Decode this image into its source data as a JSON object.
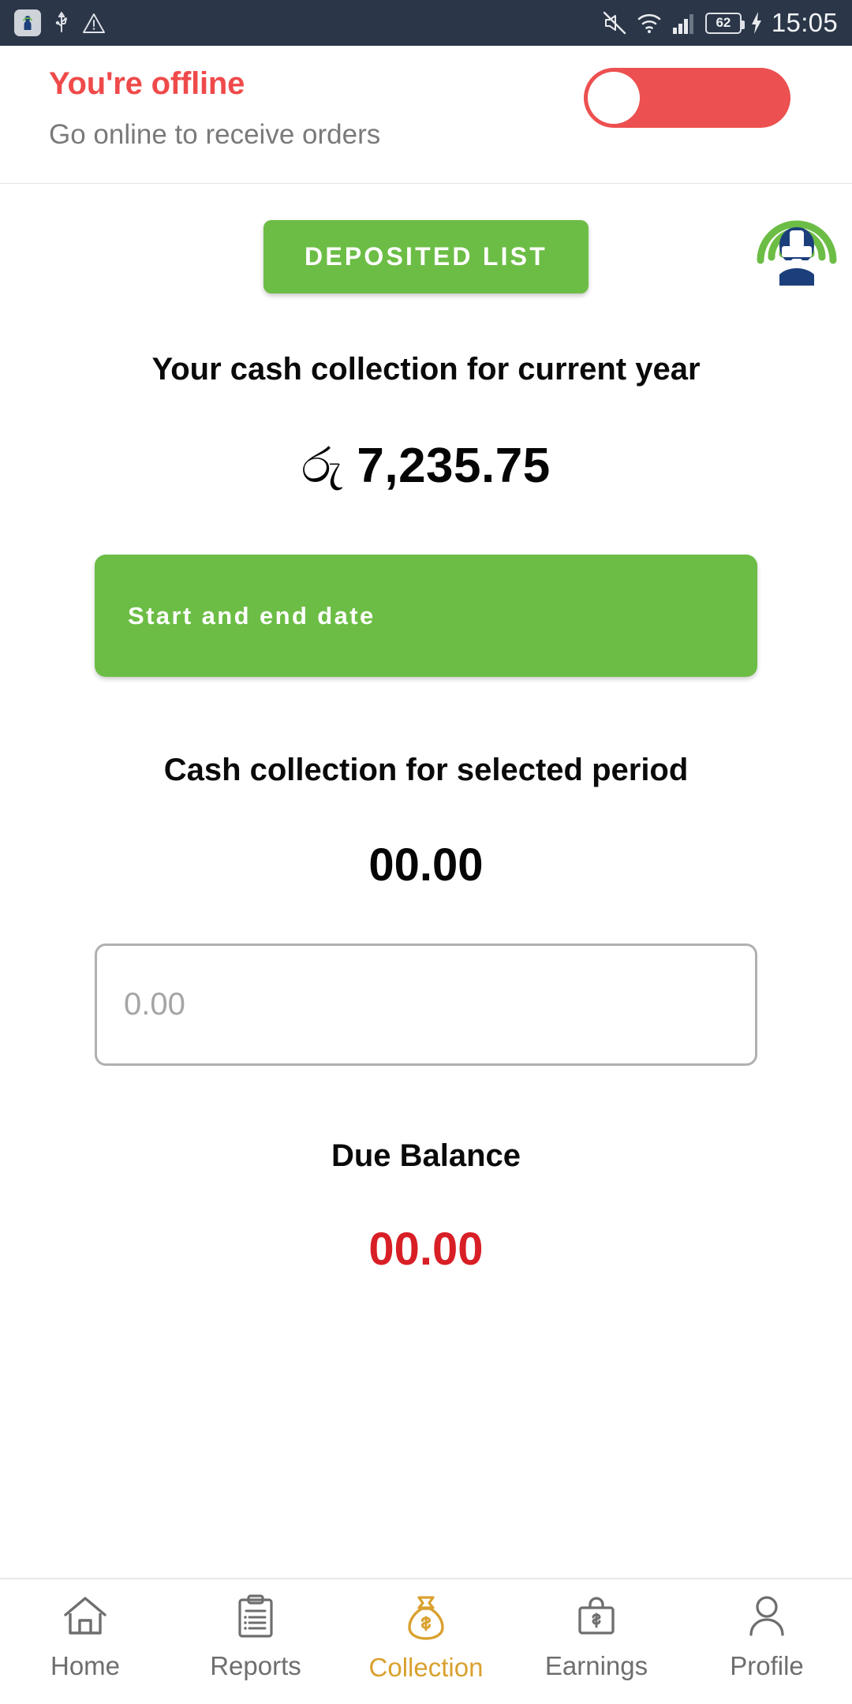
{
  "status_bar": {
    "time": "15:05",
    "battery_level": "62",
    "icons": [
      "app-notification-icon",
      "usb-icon",
      "warning-triangle-icon",
      "mute-icon",
      "wifi-icon",
      "signal-bars-icon",
      "battery-icon",
      "charging-bolt-icon"
    ],
    "background_color": "#2b3648"
  },
  "header": {
    "offline_title": "You're offline",
    "offline_subtitle": "Go online to receive orders",
    "toggle_state": "off",
    "toggle_color": "#ec5050",
    "title_color": "#ef4a4a"
  },
  "logo": {
    "name": "rider-helmet-signal-logo",
    "helmet_color": "#1b3f7a",
    "wave_color": "#6cbd45"
  },
  "main": {
    "deposited_list_button": "DEPOSITED LIST",
    "current_year_heading": "Your cash collection for current year",
    "currency_symbol": "රු",
    "current_year_amount": "7,235.75",
    "date_range_button": "Start and end date",
    "selected_period_heading": "Cash collection for selected period",
    "selected_period_amount": "00.00",
    "deposit_input_value": "",
    "deposit_input_placeholder": "0.00",
    "due_balance_heading": "Due Balance",
    "due_balance_amount": "00.00",
    "accent_green": "#6cbd45",
    "due_red": "#d81f26"
  },
  "bottom_nav": {
    "active_color": "#d9a12e",
    "inactive_color": "#6e6e6e",
    "items": [
      {
        "label": "Home",
        "icon": "home-icon",
        "active": false
      },
      {
        "label": "Reports",
        "icon": "clipboard-icon",
        "active": false
      },
      {
        "label": "Collection",
        "icon": "money-bag-icon",
        "active": true
      },
      {
        "label": "Earnings",
        "icon": "briefcase-dollar-icon",
        "active": false
      },
      {
        "label": "Profile",
        "icon": "person-icon",
        "active": false
      }
    ]
  }
}
